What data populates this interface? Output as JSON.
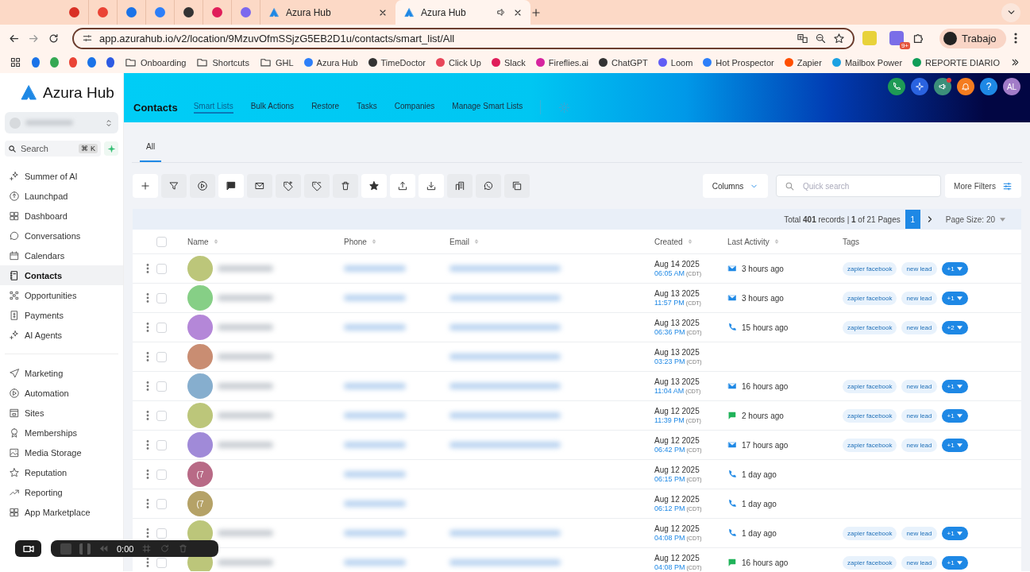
{
  "browser": {
    "tabs": [
      {
        "kind": "icon",
        "color": "#d93025"
      },
      {
        "kind": "icon",
        "color": "#ea4335"
      },
      {
        "kind": "icon",
        "color": "#1a73e8"
      },
      {
        "kind": "icon",
        "color": "#2d7ff9"
      },
      {
        "kind": "icon",
        "color": "#333333"
      },
      {
        "kind": "icon",
        "color": "#e01e5a"
      },
      {
        "kind": "icon",
        "color": "#7b68ee"
      },
      {
        "kind": "page",
        "title": "Azura Hub",
        "selected": false
      },
      {
        "kind": "page",
        "title": "Azura Hub",
        "selected": true
      }
    ],
    "url": "app.azurahub.io/v2/location/9MzuvOfmSSjzG5EB2D1u/contacts/smart_list/All",
    "extension_badge": "9+",
    "profile": "Trabajo",
    "bookmarks": [
      {
        "kind": "icon",
        "color": "#1a73e8"
      },
      {
        "kind": "icon",
        "color": "#34a853"
      },
      {
        "kind": "icon",
        "color": "#ea4335"
      },
      {
        "kind": "icon",
        "color": "#1a73e8"
      },
      {
        "kind": "icon",
        "color": "#2d5be3"
      },
      {
        "kind": "folder",
        "label": "Onboarding"
      },
      {
        "kind": "folder",
        "label": "Shortcuts"
      },
      {
        "kind": "folder",
        "label": "GHL"
      },
      {
        "kind": "site",
        "label": "Azura Hub",
        "color": "#2d7ff9"
      },
      {
        "kind": "site",
        "label": "TimeDoctor",
        "color": "#333333"
      },
      {
        "kind": "site",
        "label": "Click Up",
        "color": "#e8465a"
      },
      {
        "kind": "site",
        "label": "Slack",
        "color": "#e01e5a"
      },
      {
        "kind": "site",
        "label": "Fireflies.ai",
        "color": "#d6249f"
      },
      {
        "kind": "site",
        "label": "ChatGPT",
        "color": "#333333"
      },
      {
        "kind": "site",
        "label": "Loom",
        "color": "#625df5"
      },
      {
        "kind": "site",
        "label": "Hot Prospector",
        "color": "#2d7ff9"
      },
      {
        "kind": "site",
        "label": "Zapier",
        "color": "#ff4f00"
      },
      {
        "kind": "site",
        "label": "Mailbox Power",
        "color": "#1ba1e2"
      },
      {
        "kind": "site",
        "label": "REPORTE DIARIO",
        "color": "#0f9d58"
      }
    ]
  },
  "sidebar": {
    "brand": "Azura Hub",
    "search": {
      "placeholder": "Search",
      "shortcut": "⌘ K"
    },
    "groups": [
      [
        {
          "label": "Summer of AI",
          "selected": false
        },
        {
          "label": "Launchpad",
          "selected": false
        },
        {
          "label": "Dashboard",
          "selected": false
        },
        {
          "label": "Conversations",
          "selected": false
        },
        {
          "label": "Calendars",
          "selected": false
        },
        {
          "label": "Contacts",
          "selected": true
        },
        {
          "label": "Opportunities",
          "selected": false
        },
        {
          "label": "Payments",
          "selected": false
        },
        {
          "label": "AI Agents",
          "selected": false
        }
      ],
      [
        {
          "label": "Marketing",
          "selected": false
        },
        {
          "label": "Automation",
          "selected": false
        },
        {
          "label": "Sites",
          "selected": false
        },
        {
          "label": "Memberships",
          "selected": false
        },
        {
          "label": "Media Storage",
          "selected": false
        },
        {
          "label": "Reputation",
          "selected": false
        },
        {
          "label": "Reporting",
          "selected": false
        },
        {
          "label": "App Marketplace",
          "selected": false
        }
      ]
    ]
  },
  "header": {
    "title": "Contacts",
    "nav": [
      {
        "label": "Smart Lists",
        "selected": true
      },
      {
        "label": "Bulk Actions",
        "selected": false
      },
      {
        "label": "Restore",
        "selected": false
      },
      {
        "label": "Tasks",
        "selected": false
      },
      {
        "label": "Companies",
        "selected": false
      },
      {
        "label": "Manage Smart Lists",
        "selected": false
      }
    ],
    "help": "?",
    "avatar": "AL"
  },
  "list_tabs": [
    {
      "label": "All",
      "selected": true
    }
  ],
  "toolbar": {
    "columns": "Columns",
    "search_placeholder": "Quick search",
    "more_filters": "More Filters"
  },
  "pagination": {
    "summary": "Total **401** records | **1** of 21 Pages",
    "page": "1",
    "page_size": "Page Size: 20"
  },
  "table": {
    "all_checked": false,
    "columns": [
      "Name",
      "Phone",
      "Email",
      "Created",
      "Last Activity",
      "Tags"
    ],
    "rows": [
      {
        "checked": false,
        "color": "#bcc67a",
        "name_blurred": true,
        "phone_blurred": true,
        "email_blurred": true,
        "date": "Aug 14 2025",
        "time": "06:05 AM",
        "tz": "(CDT)",
        "activity": {
          "kind": "email",
          "text": "3 hours ago"
        },
        "tags": [
          "zapier facebook",
          "new lead"
        ],
        "more": "+1"
      },
      {
        "checked": false,
        "color": "#86cf86",
        "name_blurred": true,
        "phone_blurred": true,
        "email_blurred": true,
        "date": "Aug 13 2025",
        "time": "11:57 PM",
        "tz": "(CDT)",
        "activity": {
          "kind": "email",
          "text": "3 hours ago"
        },
        "tags": [
          "zapier facebook",
          "new lead"
        ],
        "more": "+1"
      },
      {
        "checked": false,
        "color": "#b487d8",
        "name_blurred": true,
        "phone_blurred": true,
        "email_blurred": true,
        "date": "Aug 13 2025",
        "time": "06:36 PM",
        "tz": "(CDT)",
        "activity": {
          "kind": "call",
          "text": "15 hours ago"
        },
        "tags": [
          "zapier facebook",
          "new lead"
        ],
        "more": "+2"
      },
      {
        "checked": false,
        "color": "#c98d72",
        "name_blurred": true,
        "phone_blurred": false,
        "email_blurred": true,
        "date": "Aug 13 2025",
        "time": "03:23 PM",
        "tz": "(CDT)"
      },
      {
        "checked": false,
        "color": "#86aece",
        "name_blurred": true,
        "phone_blurred": true,
        "email_blurred": true,
        "date": "Aug 13 2025",
        "time": "11:04 AM",
        "tz": "(CDT)",
        "activity": {
          "kind": "email",
          "text": "16 hours ago"
        },
        "tags": [
          "zapier facebook",
          "new lead"
        ],
        "more": "+1"
      },
      {
        "checked": false,
        "color": "#bcc67a",
        "name_blurred": true,
        "phone_blurred": true,
        "email_blurred": true,
        "date": "Aug 12 2025",
        "time": "11:39 PM",
        "tz": "(CDT)",
        "activity": {
          "kind": "sms",
          "text": "2 hours ago"
        },
        "tags": [
          "zapier facebook",
          "new lead"
        ],
        "more": "+1"
      },
      {
        "checked": false,
        "color": "#a08ad8",
        "name_blurred": true,
        "phone_blurred": true,
        "email_blurred": true,
        "date": "Aug 12 2025",
        "time": "06:42 PM",
        "tz": "(CDT)",
        "activity": {
          "kind": "email",
          "text": "17 hours ago"
        },
        "tags": [
          "zapier facebook",
          "new lead"
        ],
        "more": "+1"
      },
      {
        "checked": false,
        "color": "#b86a86",
        "initials": "(7",
        "name_blurred": false,
        "phone_blurred": true,
        "email_blurred": false,
        "date": "Aug 12 2025",
        "time": "06:15 PM",
        "tz": "(CDT)",
        "activity": {
          "kind": "call",
          "text": "1 day ago"
        }
      },
      {
        "checked": false,
        "color": "#b5a267",
        "initials": "(7",
        "name_blurred": false,
        "phone_blurred": true,
        "email_blurred": false,
        "date": "Aug 12 2025",
        "time": "06:12 PM",
        "tz": "(CDT)",
        "activity": {
          "kind": "call",
          "text": "1 day ago"
        }
      },
      {
        "checked": false,
        "color": "#bcc67a",
        "name_blurred": true,
        "phone_blurred": true,
        "email_blurred": true,
        "date": "Aug 12 2025",
        "time": "04:08 PM",
        "tz": "(CDT)",
        "activity": {
          "kind": "call",
          "text": "1 day ago"
        },
        "tags": [
          "zapier facebook",
          "new lead"
        ],
        "more": "+1"
      },
      {
        "checked": false,
        "color": "#bcc67a",
        "name_blurred": true,
        "phone_blurred": true,
        "email_blurred": true,
        "date": "Aug 12 2025",
        "time": "04:08 PM",
        "tz": "(CDT)",
        "activity": {
          "kind": "sms",
          "text": "16 hours ago"
        },
        "tags": [
          "zapier facebook",
          "new lead"
        ],
        "more": "+1"
      }
    ]
  },
  "recorder": {
    "time": "0:00"
  }
}
